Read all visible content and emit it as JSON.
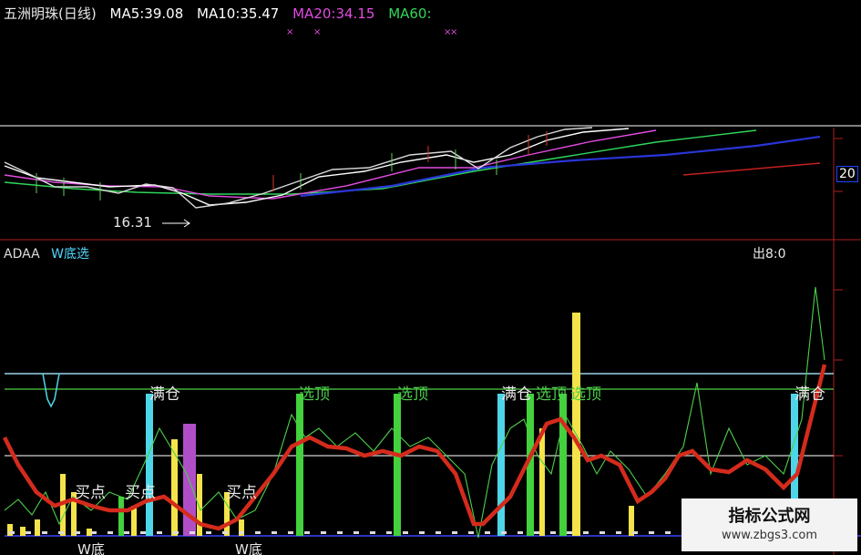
{
  "legend": {
    "stock": "五洲明珠(日线)",
    "ma5": "MA5:39.08",
    "ma10": "MA10:35.47",
    "ma20": "MA20:34.15",
    "ma60": "MA60:"
  },
  "price_low_label": "16.31",
  "indicator": {
    "name": "ADAA",
    "title": "W底选"
  },
  "right_top_text": "出8:0",
  "right_axis_value": "20",
  "signals": {
    "full_pos": "满仓",
    "select_top": "选顶",
    "buy_point": "买点",
    "w_bottom": "W底"
  },
  "watermark": {
    "title": "指标公式网",
    "url": "www.zbgs3.com"
  },
  "colors": {
    "ma20": "#e24ce0",
    "ma60": "#2fd65b",
    "bar_cyan": "#4fd5e8",
    "bar_green": "#43d13d",
    "bar_yellow": "#f4e34a",
    "bar_purple": "#b04ec8",
    "line_red": "#d42b1c"
  }
}
